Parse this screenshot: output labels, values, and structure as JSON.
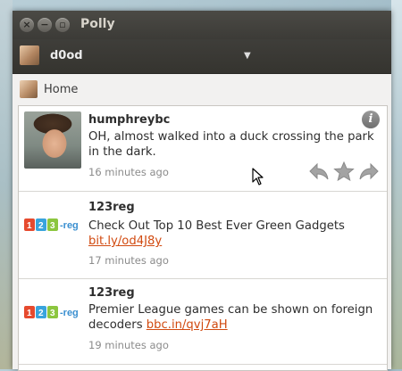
{
  "window": {
    "title": "Polly"
  },
  "account": {
    "name": "d0od"
  },
  "tab": {
    "label": "Home"
  },
  "tweets": [
    {
      "author": "humphreybc",
      "text": "OH, almost walked into a duck crossing the park in the dark.",
      "link": "",
      "time": "16 minutes ago"
    },
    {
      "author": "123reg",
      "text": "Check Out Top 10 Best Ever Green Gadgets ",
      "link": "bit.ly/od4J8y",
      "time": "17 minutes ago"
    },
    {
      "author": "123reg",
      "text": "Premier League games can be shown on foreign decoders ",
      "link": "bbc.in/qvj7aH",
      "time": "19 minutes ago"
    }
  ],
  "logo": {
    "text": "1 2 3·reg"
  },
  "colors": {
    "link": "#d14a10",
    "titlebar": "#3c3b37",
    "accountbar": "#3f3e3a"
  }
}
